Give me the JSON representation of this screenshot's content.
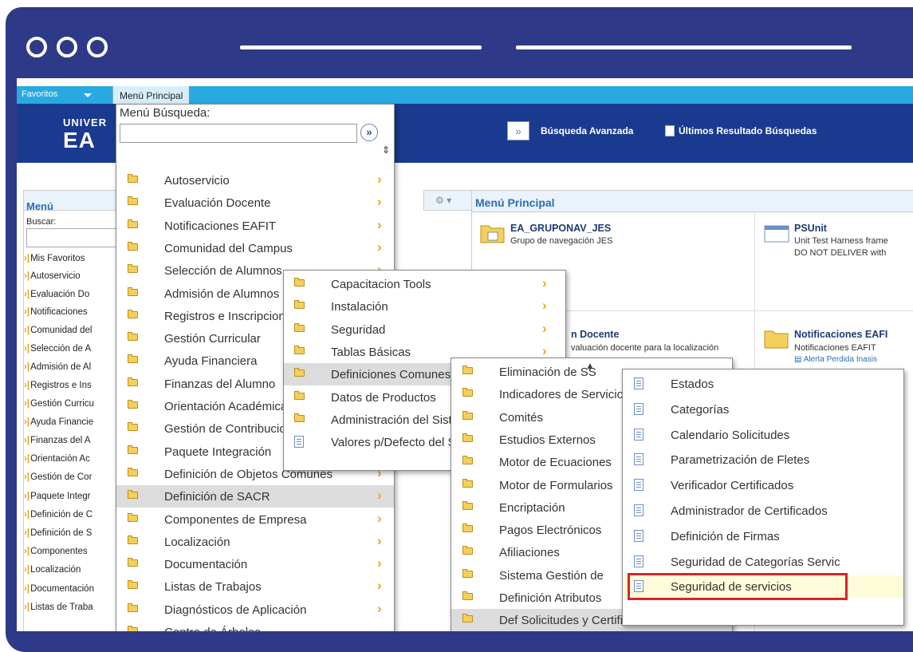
{
  "topnav": {
    "favoritos": "Favoritos",
    "menu_principal": "Menú Principal"
  },
  "banner": {
    "logo_line1": "UNIVER",
    "logo_line2": "EA",
    "busqueda_avanzada": "Búsqueda Avanzada",
    "ultimos_resultados": "Últimos Resultado Búsquedas"
  },
  "left_panel": {
    "title": "Menú",
    "search_label": "Buscar:",
    "items": [
      "Mis Favoritos",
      "Autoservicio",
      "Evaluación Do",
      "Notificaciones",
      "Comunidad del",
      "Selección de A",
      "Admisión de Al",
      "Registros e Ins",
      "Gestión Curricu",
      "Ayuda Financie",
      "Finanzas del A",
      "Orientación Ac",
      "Gestión de Cor",
      "Paquete Integr",
      "Definición de C",
      "Definición de S",
      "Componentes",
      "Localización",
      "Documentación",
      "Listas de Traba"
    ]
  },
  "right_panel": {
    "title": "Menú Principal",
    "tiles": [
      {
        "title": "EA_GRUPONAV_JES",
        "desc": "Grupo de navegación JES"
      },
      {
        "title": "PSUnit",
        "desc": "Unit Test Harness frame",
        "desc2": "DO NOT DELIVER with"
      },
      {
        "title": "n Docente",
        "desc": "valuación docente para la localización"
      },
      {
        "title": "Notificaciones EAFI",
        "desc": "Notificaciones EAFIT",
        "link": "Alerta Perdida Inasis"
      }
    ]
  },
  "menu1": {
    "search_label": "Menú Búsqueda:",
    "items": [
      "Autoservicio",
      "Evaluación Docente",
      "Notificaciones EAFIT",
      "Comunidad del Campus",
      "Selección de Alumnos",
      "Admisión de Alumnos",
      "Registros e Inscripciones",
      "Gestión Curricular",
      "Ayuda Financiera",
      "Finanzas del Alumno",
      "Orientación Académica",
      "Gestión de Contribuciones",
      "Paquete Integración",
      "Definición de Objetos Comunes",
      "Definición de SACR",
      "Componentes de Empresa",
      "Localización",
      "Documentación",
      "Listas de Trabajos",
      "Diagnósticos de Aplicación",
      "Centro de Árboles"
    ],
    "highlighted": "Definición de SACR"
  },
  "menu2": {
    "items": [
      "Capacitacion Tools",
      "Instalación",
      "Seguridad",
      "Tablas Básicas",
      "Definiciones Comunes",
      "Datos de Productos",
      "Administración del Sistema",
      "Valores p/Defecto del Sistema"
    ],
    "highlighted": "Definiciones Comunes"
  },
  "menu3": {
    "items": [
      "Eliminación de SS",
      "Indicadores de Servicio",
      "Comités",
      "Estudios Externos",
      "Motor de Ecuaciones",
      "Motor de Formularios",
      "Encriptación",
      "Pagos Electrónicos",
      "Afiliaciones",
      "Sistema Gestión de",
      "Definición Atributos",
      "Def Solicitudes y Certificados"
    ],
    "highlighted": "Def Solicitudes y Certificados"
  },
  "menu4": {
    "items": [
      "Estados",
      "Categorías",
      "Calendario Solicitudes",
      "Parametrización de Fletes",
      "Verificador Certificados",
      "Administrador de Certificados",
      "Definición de Firmas",
      "Seguridad de Categorías Servic",
      "Seguridad de servicios"
    ],
    "selected": "Seguridad de servicios"
  },
  "colors": {
    "frame": "#2e3a87",
    "topnav": "#29a9e1",
    "banner": "#1a3a8f",
    "highlight_box": "#d9232d",
    "arrow": "#f5a21a"
  }
}
